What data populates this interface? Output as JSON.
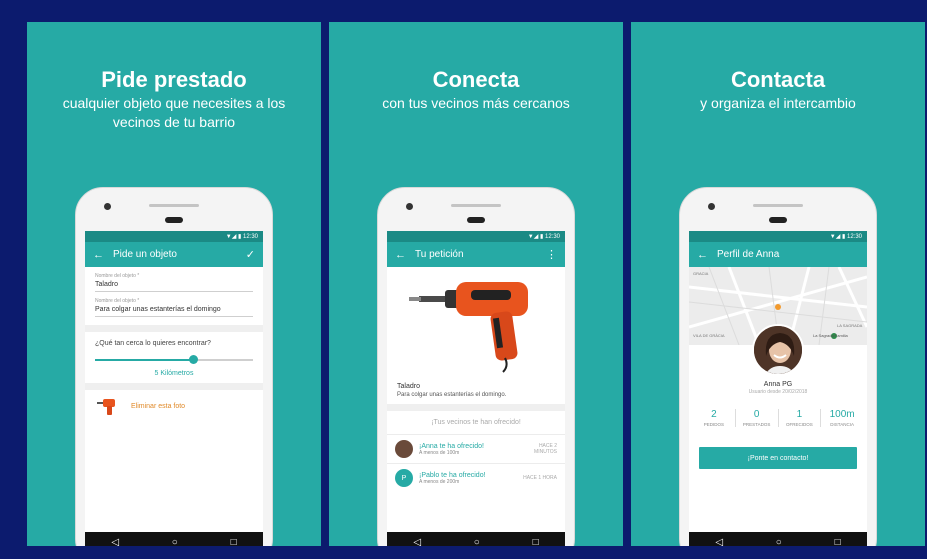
{
  "panels": [
    {
      "headline": "Pide prestado",
      "subtitle": "cualquier objeto que necesites a los vecinos de tu barrio",
      "status_time": "12:30",
      "appbar_title": "Pide un objeto",
      "field_name_label": "Nombre del objeto *",
      "field_name_value": "Taladro",
      "field_desc_label": "Nombre del objeto *",
      "field_desc_value": "Para colgar unas estanterías el domingo",
      "question": "¿Qué tan cerca lo quieres encontrar?",
      "slider_fraction": 0.62,
      "distance": "5 Kilómetros",
      "delete_photo": "Eliminar esta foto"
    },
    {
      "headline": "Conecta",
      "subtitle": "con tus vecinos más cercanos",
      "status_time": "12:30",
      "appbar_title": "Tu petición",
      "item_title": "Taladro",
      "item_desc": "Para colgar unas estanterías el domingo.",
      "offered_header": "¡Tus vecinos te han ofrecido!",
      "offers": [
        {
          "name": "¡Anna te ha ofrecido!",
          "distance": "A menos de 100m",
          "time": "HACE 2 MINUTOS",
          "avatar_letter": ""
        },
        {
          "name": "¡Pablo te ha ofrecido!",
          "distance": "A menos de 200m",
          "time": "HACE 1 HORA",
          "avatar_letter": "P"
        }
      ]
    },
    {
      "headline": "Contacta",
      "subtitle": "y organiza el intercambio",
      "status_time": "12:30",
      "appbar_title": "Perfil de Anna",
      "map_labels": [
        "GRACIA",
        "VILA DE GRÀCIA",
        "La Sagrada Familia",
        "LA SAGRADA"
      ],
      "profile_name": "Anna PG",
      "profile_since": "Usuario desde 20/02/2018",
      "stats": [
        {
          "value": "2",
          "label": "PEDIDOS"
        },
        {
          "value": "0",
          "label": "PRESTADOS"
        },
        {
          "value": "1",
          "label": "OFRECIDOS"
        },
        {
          "value": "100m",
          "label": "DISTANCIA"
        }
      ],
      "cta": "¡Ponte en contacto!"
    }
  ],
  "colors": {
    "teal": "#26aaa5",
    "teal_dark": "#1b8a85",
    "background": "#0c1b6e",
    "orange": "#e08a2a"
  },
  "icons": {
    "back": "arrow-left-icon",
    "check": "check-icon",
    "more": "more-vert-icon",
    "nav_back": "triangle-back-icon",
    "nav_home": "circle-home-icon",
    "nav_recent": "square-recent-icon"
  }
}
